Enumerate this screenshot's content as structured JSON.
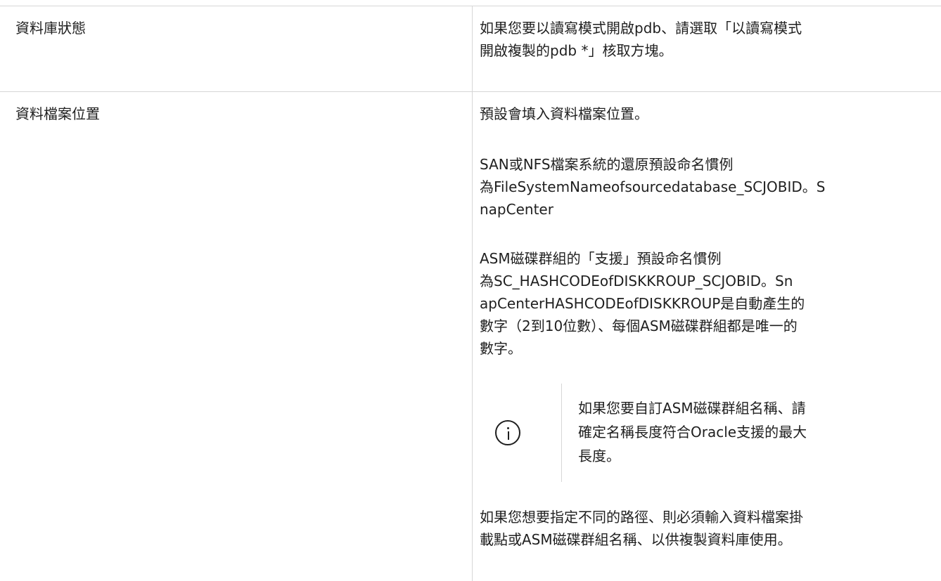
{
  "rows": [
    {
      "label": "資料庫狀態",
      "description_lines": [
        "如果您要以讀寫模式開啟pdb、請選取「以讀寫模式",
        "開啟複製的pdb *」核取方塊。"
      ]
    },
    {
      "label": "資料檔案位置",
      "paragraphs": [
        {
          "lines": [
            "預設會填入資料檔案位置。"
          ]
        },
        {
          "lines": [
            "SAN或NFS檔案系統的還原預設命名慣例",
            "為FileSystemNameofsourcedatabase_SCJOBID。S",
            "napCenter"
          ]
        },
        {
          "lines": [
            "ASM磁碟群組的「支援」預設命名慣例",
            "為SC_HASHCODEofDISKKROUP_SCJOBID。Sn",
            "apCenterHASHCODEofDISKKROUP是自動產生的",
            "數字（2到10位數）、每個ASM磁碟群組都是唯一的",
            "數字。"
          ]
        },
        {
          "lines": [
            "如果您想要指定不同的路徑、則必須輸入資料檔案掛",
            "載點或ASM磁碟群組名稱、以供複製資料庫使用。"
          ]
        }
      ],
      "note": {
        "icon": "info-icon",
        "lines": [
          "如果您要自訂ASM磁碟群組名稱、請",
          "確定名稱長度符合Oracle支援的最大",
          "長度。"
        ]
      }
    }
  ]
}
